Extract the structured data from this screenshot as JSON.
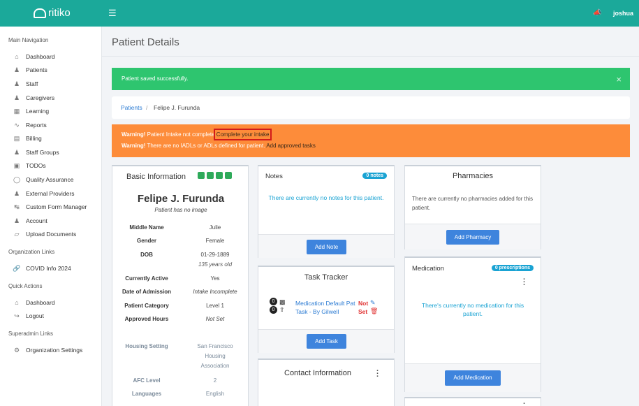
{
  "topbar": {
    "brand": "ritiko",
    "menu_icon": "hamburger-icon",
    "notify_icon": "megaphone-icon",
    "user": "joshua"
  },
  "sidebar": {
    "main_nav_heading": "Main Navigation",
    "main_items": [
      {
        "label": "Dashboard",
        "icon": "home-icon"
      },
      {
        "label": "Patients",
        "icon": "patients-icon"
      },
      {
        "label": "Staff",
        "icon": "staff-icon"
      },
      {
        "label": "Caregivers",
        "icon": "caregivers-icon"
      },
      {
        "label": "Learning",
        "icon": "learning-icon"
      },
      {
        "label": "Reports",
        "icon": "reports-icon"
      },
      {
        "label": "Billing",
        "icon": "billing-icon"
      },
      {
        "label": "Staff Groups",
        "icon": "staff-groups-icon"
      },
      {
        "label": "TODOs",
        "icon": "todos-icon"
      },
      {
        "label": "Quality Assurance",
        "icon": "quality-icon"
      },
      {
        "label": "External Providers",
        "icon": "external-providers-icon"
      },
      {
        "label": "Custom Form Manager",
        "icon": "sliders-icon"
      },
      {
        "label": "Account",
        "icon": "account-icon"
      },
      {
        "label": "Upload Documents",
        "icon": "upload-icon"
      }
    ],
    "org_links_heading": "Organization Links",
    "org_items": [
      {
        "label": "COVID Info 2024",
        "icon": "link-icon"
      }
    ],
    "quick_actions_heading": "Quick Actions",
    "quick_items": [
      {
        "label": "Dashboard",
        "icon": "home-icon"
      },
      {
        "label": "Logout",
        "icon": "logout-icon"
      }
    ],
    "superadmin_heading": "Superadmin Links",
    "superadmin_items": [
      {
        "label": "Organization Settings",
        "icon": "gear-icon"
      }
    ]
  },
  "page": {
    "title": "Patient Details"
  },
  "success_alert": {
    "message": "Patient saved successfully.",
    "close": "×"
  },
  "breadcrumb": {
    "parent": "Patients",
    "separator": "/",
    "current": "Felipe J. Furunda"
  },
  "warning": {
    "label": "Warning!",
    "line1_text": "Patient Intake not complete",
    "line1_link": "Complete your intake",
    "line2_text": "There are no IADLs or ADLs defined for patient.",
    "line2_link": "Add approved tasks"
  },
  "basic_info": {
    "title": "Basic Information",
    "name": "Felipe J. Furunda",
    "image_note": "Patient has no image",
    "rows": [
      {
        "key": "Middle Name",
        "value": "Julie"
      },
      {
        "key": "Gender",
        "value": "Female"
      },
      {
        "key": "DOB",
        "value": "01-29-1889",
        "sub": "135 years old"
      },
      {
        "key": "Currently Active",
        "value": "Yes"
      },
      {
        "key": "Date of Admission",
        "value": "Intake Incomplete"
      },
      {
        "key": "Patient Category",
        "value": "Level 1"
      },
      {
        "key": "Approved Hours",
        "value": "Not Set"
      },
      {
        "key": "Housing Setting",
        "value_lines": [
          "San Francisco",
          "Housing",
          "Association"
        ]
      },
      {
        "key": "AFC Level",
        "value": "2"
      },
      {
        "key": "Languages",
        "value": "English"
      }
    ]
  },
  "notes": {
    "title": "Notes",
    "badge": "0 notes",
    "empty": "There are currently no notes for this patient.",
    "button": "Add Note"
  },
  "task_tracker": {
    "title": "Task Tracker",
    "task_title": "Medication Default Pat Task - By Gilwell",
    "status": "Not Set",
    "count_a": "0",
    "count_b": "0",
    "button": "Add Task"
  },
  "contact": {
    "title": "Contact Information"
  },
  "pharmacies": {
    "title": "Pharmacies",
    "empty": "There are currently no pharmacies added for this patient.",
    "button": "Add Pharmacy"
  },
  "medication": {
    "title": "Medication",
    "badge": "0 prescriptions",
    "empty": "There's currently no medication for this patient.",
    "button": "Add Medication"
  },
  "colors": {
    "topbar": "#1ba99a",
    "success": "#2ec56f",
    "warning": "#fd8c3a",
    "primary": "#3e84dd",
    "badge": "#1aa3d3",
    "highlight": "#d11a1a"
  }
}
